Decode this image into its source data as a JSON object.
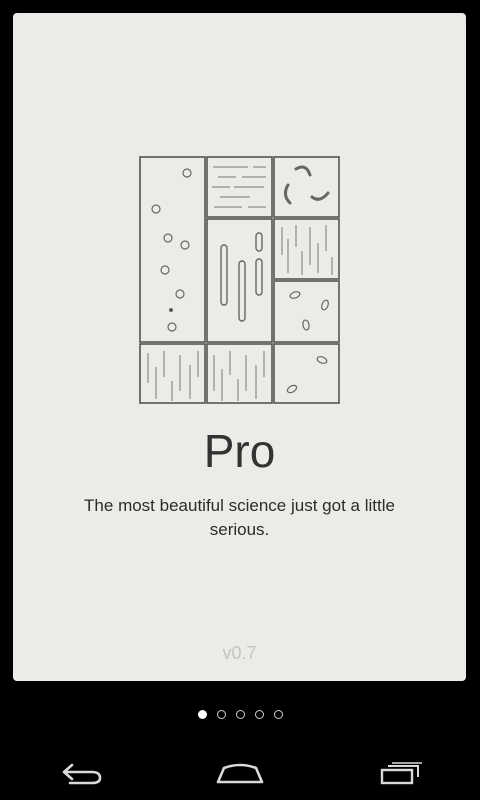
{
  "card": {
    "title": "Pro",
    "tagline": "The most beautiful science just got a little serious.",
    "version": "v0.7"
  },
  "pager": {
    "count": 5,
    "active_index": 0
  },
  "navbar": {
    "back": "back-icon",
    "home": "home-icon",
    "recents": "recents-icon"
  },
  "colors": {
    "background": "#000000",
    "card": "#ebebe8",
    "text": "#333333",
    "version": "#c4c4c2"
  }
}
